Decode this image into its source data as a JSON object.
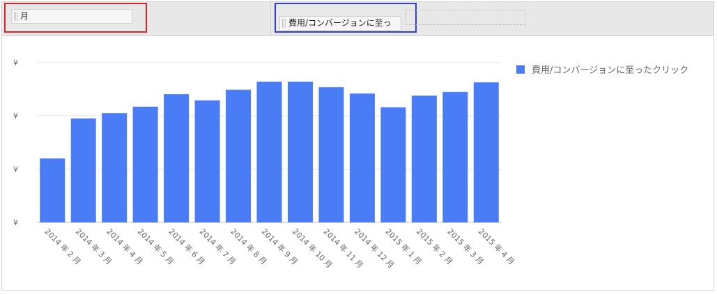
{
  "toolbar": {
    "rows_field": "月",
    "values_field": "費用/コンバージョンに至っ"
  },
  "colors": {
    "bar": "#4a7cf6",
    "grid": "#e5e5e5",
    "axis": "#bdbdbd",
    "text": "#666666"
  },
  "chart_data": {
    "type": "bar",
    "categories": [
      "2014 年 2 月",
      "2014 年 3 月",
      "2014 年 4 月",
      "2014 年 5 月",
      "2014 年 6 月",
      "2014 年 7 月",
      "2014 年 8 月",
      "2014 年 9 月",
      "2014 年 10 月",
      "2014 年 11 月",
      "2014 年 12 月",
      "2015 年 1 月",
      "2015 年 2 月",
      "2015 年 3 月",
      "2015 年 4 月"
    ],
    "series": [
      {
        "name": "費用/コンバージョンに至ったクリック",
        "values": [
          1.2,
          1.95,
          2.05,
          2.17,
          2.41,
          2.29,
          2.49,
          2.64,
          2.64,
          2.54,
          2.42,
          2.16,
          2.38,
          2.45,
          2.63
        ]
      }
    ],
    "ylim": [
      0,
      3
    ],
    "yticks": [
      0,
      1,
      2,
      3
    ],
    "ytick_labels": [
      "¥",
      "¥",
      "¥",
      "¥"
    ],
    "grid": true,
    "legend_position": "right"
  }
}
